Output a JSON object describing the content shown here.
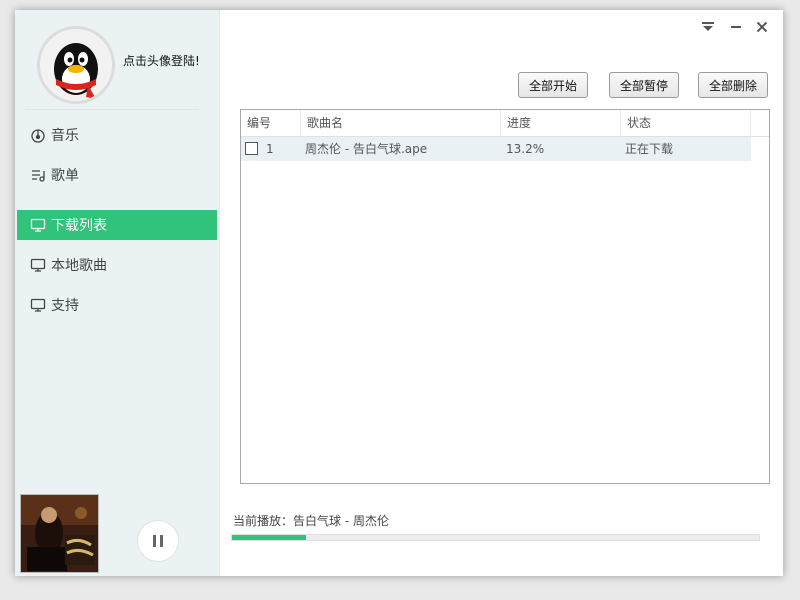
{
  "user": {
    "login_prompt": "点击头像登陆!"
  },
  "nav": {
    "items": [
      {
        "label": "音乐",
        "icon": "music-note-icon"
      },
      {
        "label": "歌单",
        "icon": "playlist-icon"
      },
      {
        "label": "下载列表",
        "icon": "monitor-icon",
        "active": true
      },
      {
        "label": "本地歌曲",
        "icon": "monitor-icon"
      },
      {
        "label": "支持",
        "icon": "monitor-icon"
      }
    ]
  },
  "toolbar": {
    "start_all": "全部开始",
    "pause_all": "全部暂停",
    "delete_all": "全部删除"
  },
  "table": {
    "headers": [
      "编号",
      "歌曲名",
      "进度",
      "状态"
    ],
    "rows": [
      {
        "index": "1",
        "name": "周杰伦 - 告白气球.ape",
        "progress": "13.2%",
        "status": "正在下载"
      }
    ]
  },
  "player": {
    "now_playing": "当前播放：告白气球 - 周杰伦",
    "progress": 0.14,
    "state": "playing"
  },
  "colors": {
    "accent": "#31c27c",
    "sidebar_bg": "#eaf2f4",
    "selected_row": "#e9f1f4"
  }
}
